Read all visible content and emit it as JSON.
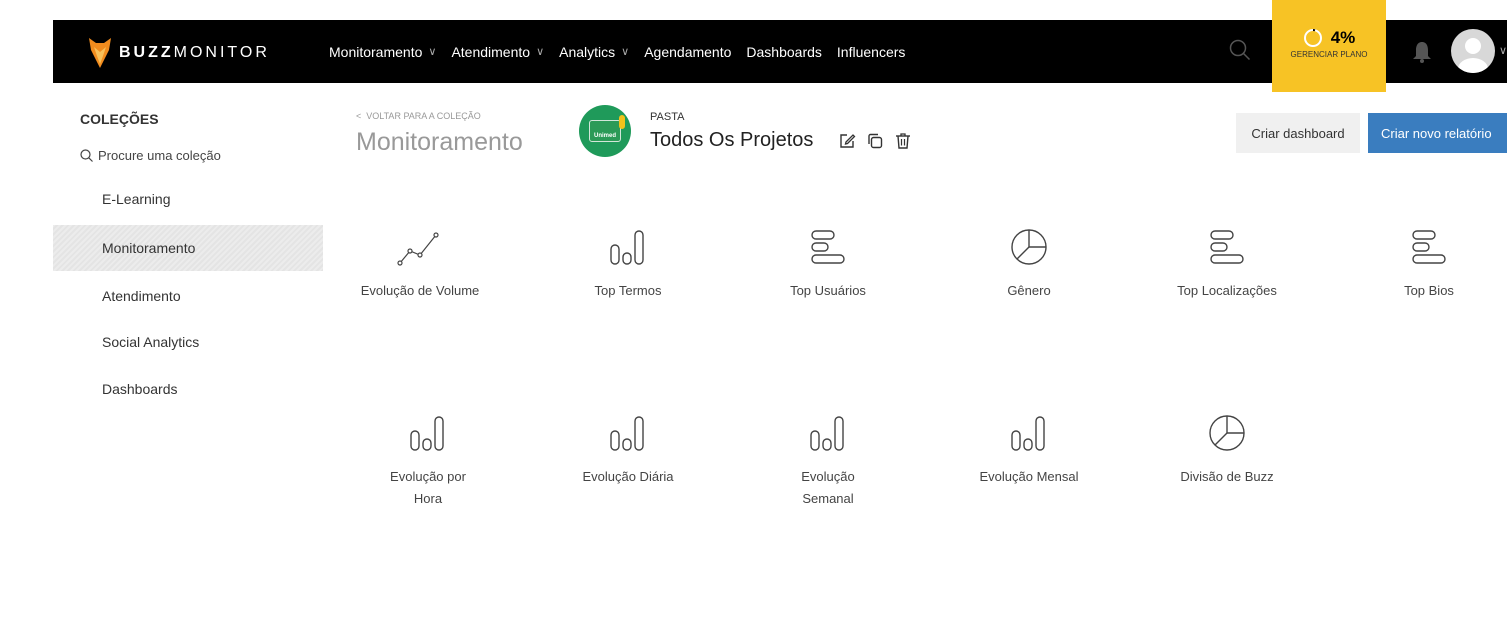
{
  "app": {
    "logo_bold": "BUZZ",
    "logo_light": "MONITOR"
  },
  "nav": [
    {
      "label": "Monitoramento",
      "has_dropdown": true
    },
    {
      "label": "Atendimento",
      "has_dropdown": true
    },
    {
      "label": "Analytics",
      "has_dropdown": true
    },
    {
      "label": "Agendamento",
      "has_dropdown": false
    },
    {
      "label": "Dashboards",
      "has_dropdown": false
    },
    {
      "label": "Influencers",
      "has_dropdown": false
    }
  ],
  "plan": {
    "percent": "4%",
    "label": "GERENCIAR PLANO",
    "color": "#f7c325"
  },
  "sidebar": {
    "title": "COLEÇÕES",
    "search_placeholder": "Procure uma coleção",
    "items": [
      {
        "label": "E-Learning",
        "active": false
      },
      {
        "label": "Monitoramento",
        "active": true
      },
      {
        "label": "Atendimento",
        "active": false
      },
      {
        "label": "Social Analytics",
        "active": false
      },
      {
        "label": "Dashboards",
        "active": false
      }
    ]
  },
  "header": {
    "back_label": "VOLTAR PARA A COLEÇÃO",
    "collection_title": "Monitoramento",
    "folder_type": "PASTA",
    "folder_title": "Todos Os Projetos",
    "folder_badge": "Unimed",
    "create_dashboard": "Criar dashboard",
    "create_report": "Criar novo relatório",
    "accent_color": "#3a7dbf"
  },
  "reports": [
    {
      "label": "Evolução de Volume",
      "icon": "line-chart-icon"
    },
    {
      "label": "Top Termos",
      "icon": "bar-chart-icon"
    },
    {
      "label": "Top Usuários",
      "icon": "horizontal-bars-icon"
    },
    {
      "label": "Gênero",
      "icon": "pie-chart-icon"
    },
    {
      "label": "Top Localizações",
      "icon": "horizontal-bars-icon"
    },
    {
      "label": "Top Bios",
      "icon": "horizontal-bars-icon"
    },
    {
      "label": "Evolução por Hora",
      "icon": "bar-chart-icon"
    },
    {
      "label": "Evolução Diária",
      "icon": "bar-chart-icon"
    },
    {
      "label": "Evolução Semanal",
      "icon": "bar-chart-icon"
    },
    {
      "label": "Evolução Mensal",
      "icon": "bar-chart-icon"
    },
    {
      "label": "Divisão de Buzz",
      "icon": "pie-chart-icon"
    }
  ]
}
